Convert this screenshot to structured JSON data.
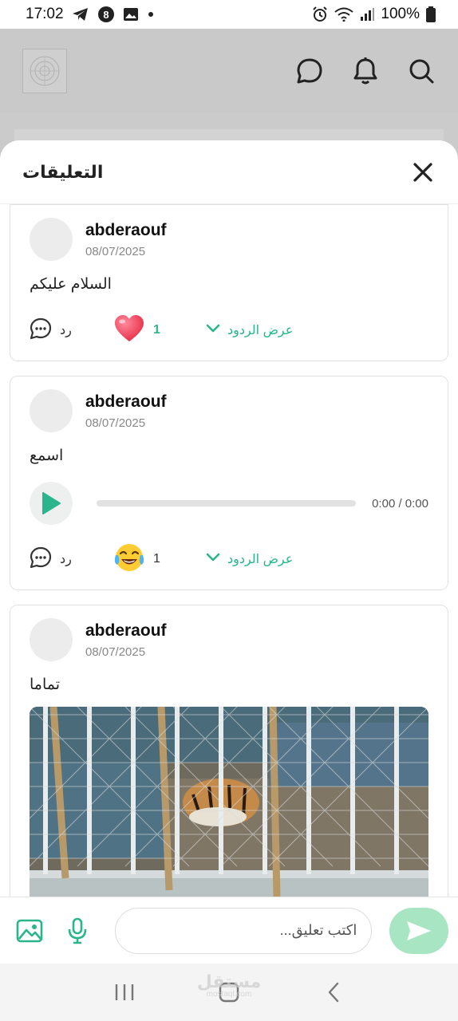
{
  "status_bar": {
    "time": "17:02",
    "battery": "100%"
  },
  "app_header": {
    "icons": [
      "chat-bubble-icon",
      "bell-icon",
      "search-icon"
    ]
  },
  "sheet": {
    "title": "التعليقات"
  },
  "comments": [
    {
      "author": "abderaouf",
      "date": "08/07/2025",
      "text": "السلام عليكم",
      "reply_label": "رد",
      "reaction": {
        "emoji": "heart",
        "count": "1"
      },
      "show_replies_label": "عرض الردود"
    },
    {
      "author": "abderaouf",
      "date": "08/07/2025",
      "text": "اسمع",
      "audio": {
        "time": "0:00 / 0:00",
        "progress": 0
      },
      "reply_label": "رد",
      "reaction": {
        "emoji": "tears-of-joy",
        "count": "1"
      },
      "show_replies_label": "عرض الردود"
    },
    {
      "author": "abderaouf",
      "date": "08/07/2025",
      "text": "تماما",
      "image": "tiger-in-cage-photo"
    }
  ],
  "composer": {
    "placeholder": "اكتب تعليق..."
  },
  "colors": {
    "accent": "#2ab58d",
    "send_button": "#a8e6c3"
  },
  "watermark": {
    "text": "مستقل",
    "sub": "mostaql.com"
  }
}
